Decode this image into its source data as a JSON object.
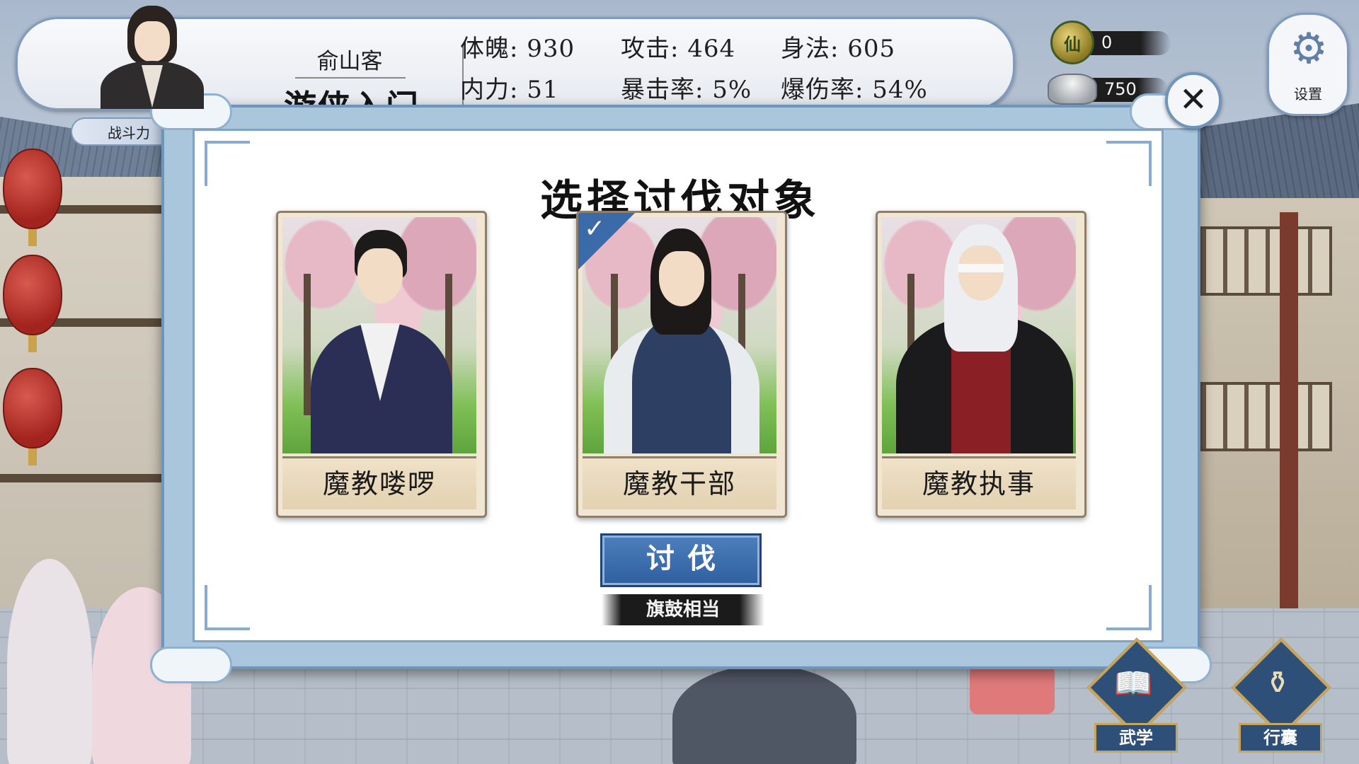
{
  "hero": {
    "name": "俞山客",
    "rank": "游侠入门",
    "power_label": "战斗力"
  },
  "stats": {
    "constitution": "体魄: 930",
    "attack": "攻击: 464",
    "agility": "身法: 605",
    "inner_force": "内力: 51",
    "crit_rate": "暴击率: 5%",
    "crit_damage": "爆伤率: 54%"
  },
  "currency": {
    "coin": "0",
    "coin_icon": "coin-icon",
    "silver": "750",
    "silver_icon": "silver-ingot-icon"
  },
  "settings": {
    "label": "设置",
    "icon": "gear-icon"
  },
  "dialog": {
    "title": "选择讨伐对象",
    "targets": [
      {
        "label": "魔教喽啰",
        "selected": false
      },
      {
        "label": "魔教干部",
        "selected": true
      },
      {
        "label": "魔教执事",
        "selected": false
      }
    ],
    "attack_label": "讨伐",
    "hint": "旗鼓相当"
  },
  "nav": {
    "martial": "武学",
    "bag": "行囊"
  },
  "colors": {
    "accent": "#2f5f9e",
    "frame": "#6f95bb",
    "card_label": "#e3d1b1"
  }
}
